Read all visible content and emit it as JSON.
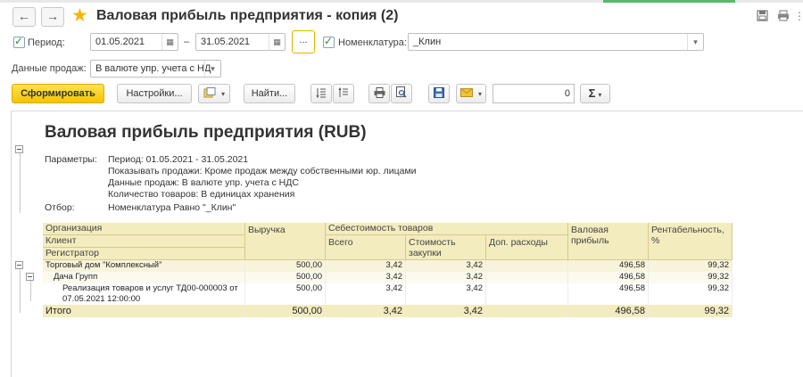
{
  "window": {
    "title": "Валовая прибыль предприятия - копия (2)",
    "back_icon": "←",
    "forward_icon": "→",
    "star_icon": "★"
  },
  "filters": {
    "period_label": "Период:",
    "period_from": "01.05.2021",
    "period_to": "31.05.2021",
    "period_dash": "–",
    "period_choose": "...",
    "nomenclature_label": "Номенклатура:",
    "nomenclature_value": "_Клин",
    "sales_label": "Данные продаж:",
    "sales_value": "В валюте упр. учета с НД"
  },
  "toolbar": {
    "generate": "Сформировать",
    "settings": "Настройки...",
    "find": "Найти...",
    "number": "0"
  },
  "report": {
    "title": "Валовая прибыль предприятия (RUB)",
    "params_label": "Параметры:",
    "params": [
      "Период: 01.05.2021 - 31.05.2021",
      "Показывать продажи: Кроме продаж между собственными юр. лицами",
      "Данные продаж: В валюте упр. учета с НДС",
      "Количество товаров: В единицах хранения"
    ],
    "filter_label": "Отбор:",
    "filter_value": "Номенклатура Равно \"_Клин\""
  },
  "table": {
    "headers": {
      "org": "Организация",
      "client": "Клиент",
      "registrar": "Регистратор",
      "revenue": "Выручка",
      "cost": "Себестоимость товаров",
      "cost_total": "Всего",
      "cost_purchase": "Стоимость закупки",
      "extra": "Доп. расходы",
      "gross": "Валовая прибыль",
      "margin": "Рентабельность, %"
    },
    "rows": [
      {
        "name": "Торговый дом \"Комплексный\"",
        "revenue": "500,00",
        "cost_total": "3,42",
        "cost_purchase": "3,42",
        "extra": "",
        "gross": "496,58",
        "margin": "99,32"
      },
      {
        "name": "Дача Групп",
        "revenue": "500,00",
        "cost_total": "3,42",
        "cost_purchase": "3,42",
        "extra": "",
        "gross": "496,58",
        "margin": "99,32"
      },
      {
        "name": "Реализация товаров и услуг ТД00-000003 от",
        "name2": "07.05.2021 12:00:00",
        "revenue": "500,00",
        "cost_total": "3,42",
        "cost_purchase": "3,42",
        "extra": "",
        "gross": "496,58",
        "margin": "99,32"
      }
    ],
    "total": {
      "name": "Итого",
      "revenue": "500,00",
      "cost_total": "3,42",
      "cost_purchase": "3,42",
      "extra": "",
      "gross": "496,58",
      "margin": "99,32"
    }
  },
  "colors": {
    "header_fill": "#f3ecbf",
    "primary_button": "#f5c400",
    "star": "#f5b800",
    "check": "#2a8c3a"
  }
}
